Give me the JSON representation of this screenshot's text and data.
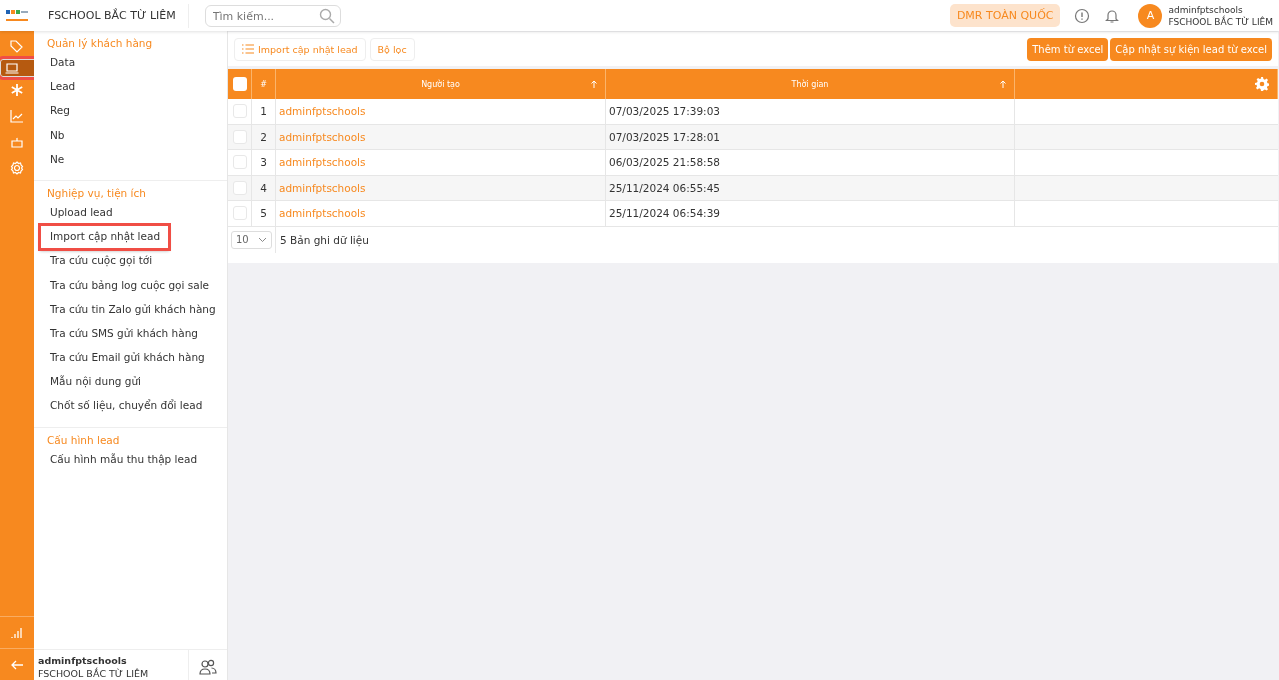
{
  "header": {
    "title": "FSCHOOL BẮC TỪ LIÊM",
    "search": {
      "placeholder": "Tìm kiếm..."
    },
    "scope_button": "DMR TOÀN QUỐC",
    "user": {
      "avatar": "A",
      "name": "adminfptschools",
      "unit": "FSCHOOL BẮC TỪ LIÊM"
    }
  },
  "rail": {
    "top": [
      {
        "selected": false,
        "highlighted": false
      },
      {
        "selected": true,
        "highlighted": true
      },
      {
        "selected": false,
        "highlighted": false
      },
      {
        "selected": false,
        "highlighted": false
      },
      {
        "selected": false,
        "highlighted": false
      },
      {
        "selected": false,
        "highlighted": false
      }
    ],
    "bottom": [
      {
        "selected": false
      },
      {
        "selected": false
      }
    ]
  },
  "menu": {
    "sections": [
      {
        "title": "Quản lý khách hàng",
        "items": [
          {
            "label": "Data",
            "highlighted": false
          },
          {
            "label": "Lead",
            "highlighted": false
          },
          {
            "label": "Reg",
            "highlighted": false
          },
          {
            "label": "Nb",
            "highlighted": false
          },
          {
            "label": "Ne",
            "highlighted": false
          }
        ]
      },
      {
        "title": "Nghiệp vụ, tiện ích",
        "items": [
          {
            "label": "Upload lead",
            "highlighted": false
          },
          {
            "label": "Import cập nhật lead",
            "highlighted": true
          },
          {
            "label": "Tra cứu cuộc gọi tới",
            "highlighted": false
          },
          {
            "label": "Tra cứu bảng log cuộc gọi sale",
            "highlighted": false
          },
          {
            "label": "Tra cứu tin Zalo gửi khách hàng",
            "highlighted": false
          },
          {
            "label": "Tra cứu SMS gửi khách hàng",
            "highlighted": false
          },
          {
            "label": "Tra cứu Email gửi khách hàng",
            "highlighted": false
          },
          {
            "label": "Mẫu nội dung gửi",
            "highlighted": false
          },
          {
            "label": "Chốt số liệu, chuyển đổi lead",
            "highlighted": false
          }
        ]
      },
      {
        "title": "Cấu hình lead",
        "items": [
          {
            "label": "Cấu hình mẫu thu thập lead",
            "highlighted": false
          }
        ]
      }
    ],
    "footer": {
      "name": "adminfptschools",
      "unit": "FSCHOOL BẮC TỪ LIÊM"
    }
  },
  "toolbar": {
    "left": [
      "Import cập nhật lead",
      "Bộ lọc"
    ],
    "right": [
      "Thêm từ excel",
      "Cập nhật sự kiện lead từ excel"
    ]
  },
  "table": {
    "columns": [
      "#",
      "Người tạo",
      "Thời gian"
    ],
    "all_checked": false,
    "rows": [
      {
        "checked": false,
        "no": "1",
        "creator": "adminfptschools",
        "time": "07/03/2025 17:39:03"
      },
      {
        "checked": false,
        "no": "2",
        "creator": "adminfptschools",
        "time": "07/03/2025 17:28:01"
      },
      {
        "checked": false,
        "no": "3",
        "creator": "adminfptschools",
        "time": "06/03/2025 21:58:58"
      },
      {
        "checked": false,
        "no": "4",
        "creator": "adminfptschools",
        "time": "25/11/2024 06:55:45"
      },
      {
        "checked": false,
        "no": "5",
        "creator": "adminfptschools",
        "time": "25/11/2024 06:54:39"
      }
    ],
    "page_size": "10",
    "count": "5 Bản ghi dữ liệu"
  }
}
